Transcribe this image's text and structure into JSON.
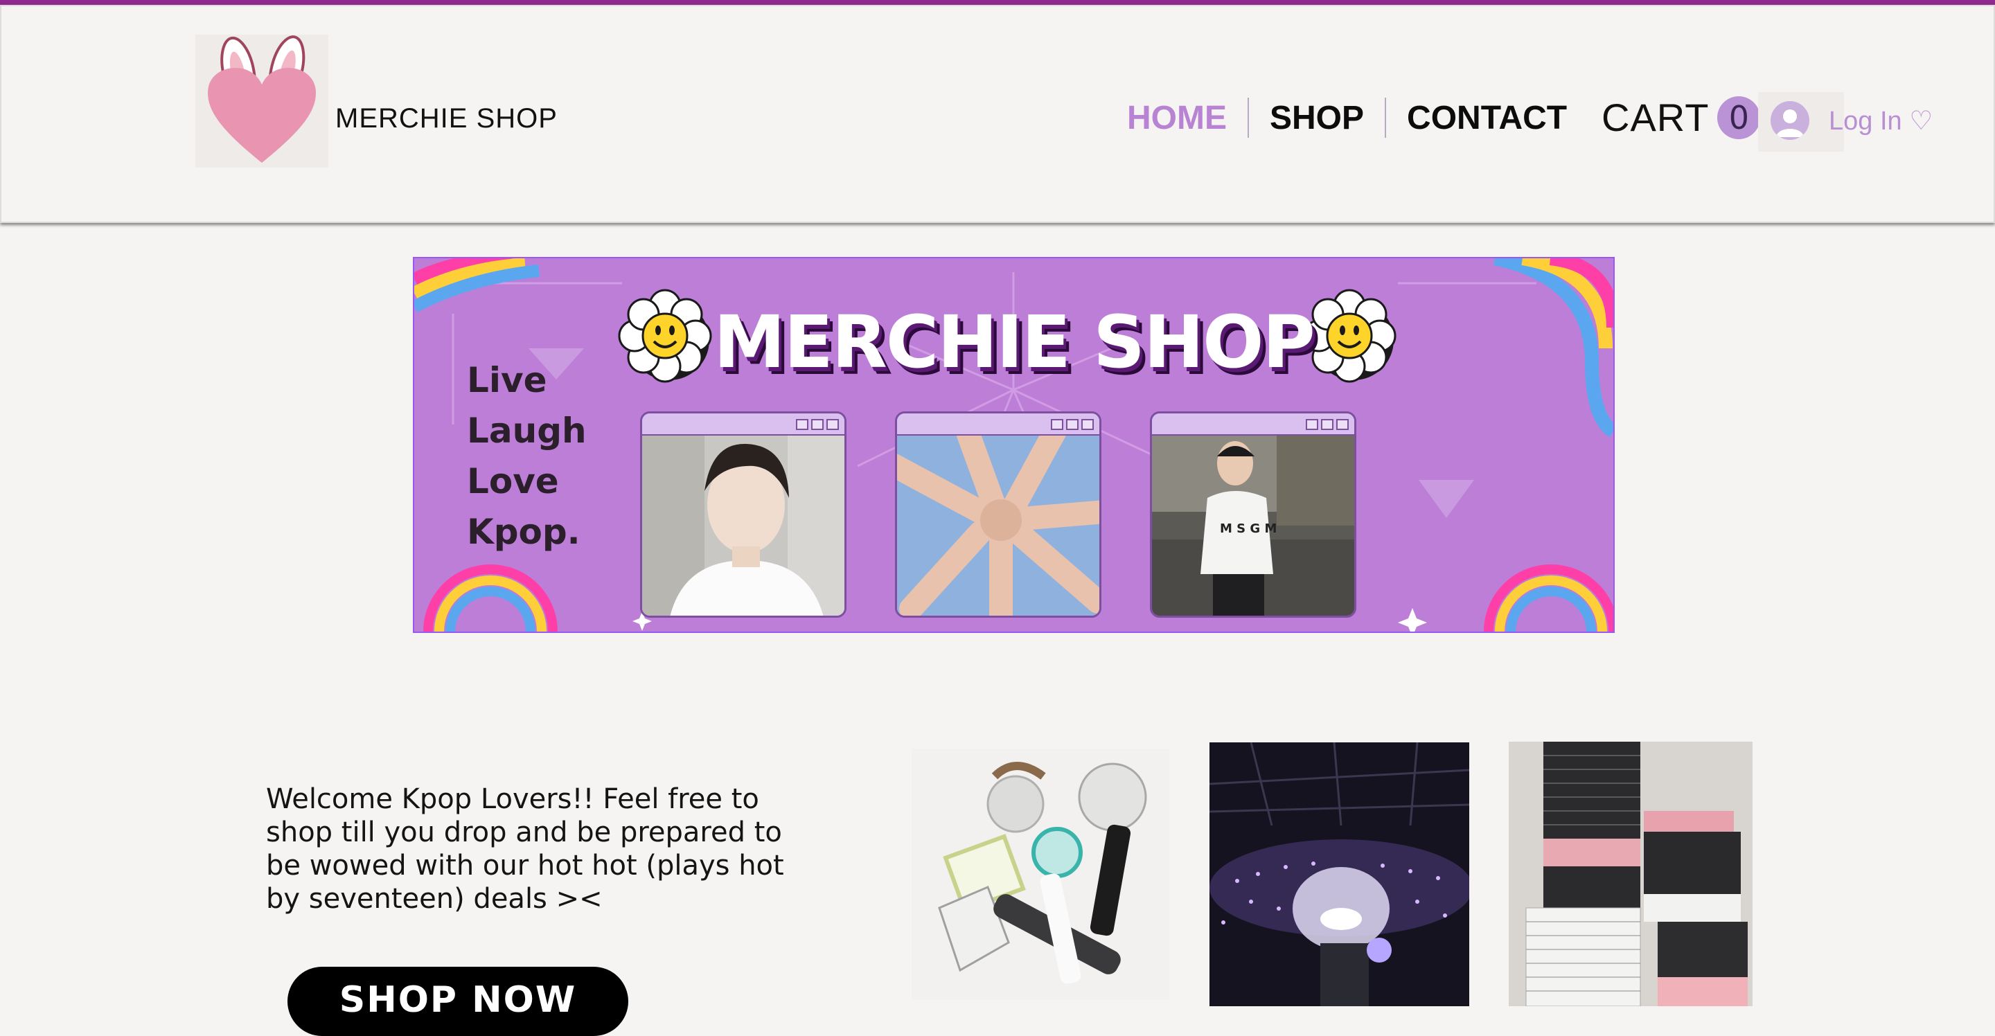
{
  "brand": {
    "name": "MERCHIE SHOP"
  },
  "nav": {
    "home": "HOME",
    "shop": "SHOP",
    "contact": "CONTACT"
  },
  "cart": {
    "label": "CART",
    "count": "0"
  },
  "login": {
    "label": "Log In ♡"
  },
  "banner": {
    "title": "MERCHIE SHOP",
    "tagline": [
      "Live",
      "Laugh",
      "Love",
      "Kpop."
    ]
  },
  "welcome": {
    "text": "Welcome Kpop Lovers!! Feel free to shop till you drop and be prepared to be wowed with our hot hot (plays hot by seventeen) deals ><"
  },
  "cta": {
    "label": "SHOP NOW"
  },
  "colors": {
    "accent": "#b883d3",
    "banner_bg": "#bd7ed7",
    "top_line": "#8e2a8e"
  },
  "icons": [
    "bunny-heart-logo",
    "user-avatar-icon",
    "smiley-flower-icon"
  ]
}
